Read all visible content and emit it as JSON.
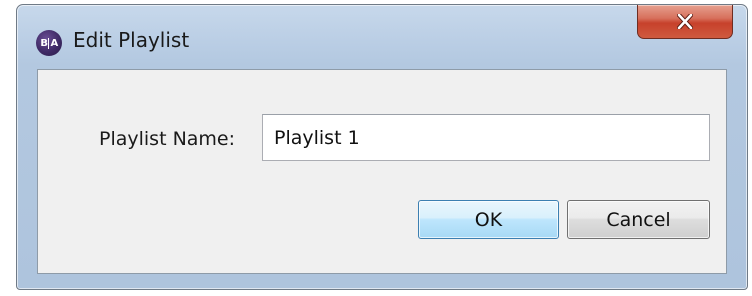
{
  "window": {
    "title": "Edit Playlist",
    "app_icon_text_left": "B",
    "app_icon_text_right": "A",
    "close_glyph": "close-icon"
  },
  "form": {
    "playlist_name_label": "Playlist Name:",
    "playlist_name_value": "Playlist 1"
  },
  "buttons": {
    "ok_label": "OK",
    "cancel_label": "Cancel"
  },
  "colors": {
    "close_button": "#c7412b",
    "ok_button_border": "#3c7fb1",
    "app_icon": "#3f2a66"
  }
}
